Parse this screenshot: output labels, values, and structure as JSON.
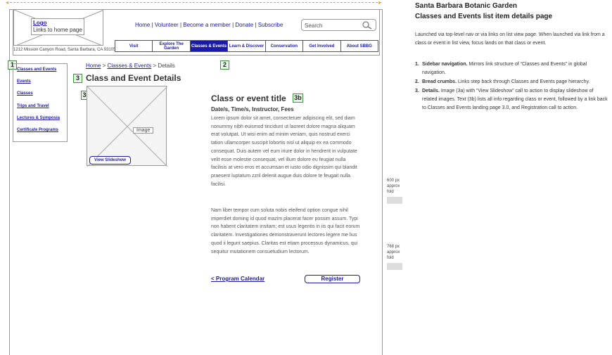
{
  "header": {
    "logo_title": "Logo",
    "logo_subtitle": "Links to home page",
    "address": "1212 Mission Canyon Road, Santa Barbara, CA 93105",
    "utility_links": [
      "Home",
      "Volunteer",
      "Become a member",
      "Donate",
      "Subscribe"
    ],
    "search_placeholder": "Search"
  },
  "nav": [
    {
      "label": "Visit",
      "active": false
    },
    {
      "label": "Explore The Garden",
      "active": false
    },
    {
      "label": "Classes & Events",
      "active": true
    },
    {
      "label": "Learn & Discover",
      "active": false
    },
    {
      "label": "Conservation",
      "active": false
    },
    {
      "label": "Get Involved",
      "active": false
    },
    {
      "label": "About SBBG",
      "active": false
    }
  ],
  "callouts": {
    "c1": "1",
    "c2": "2",
    "c3": "3",
    "c3a": "3a",
    "c3b": "3b"
  },
  "sidebar": {
    "items": [
      "Classes and Events",
      "Events",
      "Classes",
      "Trips and Travel",
      "Lectures & Symposia",
      "Certificate Programs"
    ]
  },
  "breadcrumb": {
    "home": "Home",
    "section": "Classes & Events",
    "current": "Details",
    "sep": ">"
  },
  "main": {
    "page_title": "Class and Event Details",
    "image_label": "Image",
    "slideshow_label": "View Slideshow",
    "event_title": "Class or event title",
    "event_meta": "Date/s, Time/s, Instructor, Fees",
    "paragraph1": "Lorem ipsum dolor sit amet, consectetuer adipiscing elit, sed diam nonummy nibh euismod tincidunt ut laoreet dolore magna aliquam erat volutpat. Ut wisi enim ad minim veniam, quis nostrud exerci tation ullamcorper suscipit lobortis nisl ut aliquip ex ea commodo consequat. Duis autem vel eum iriure dolor in hendrerit in vulputate velit esse molestie consequat, vel illum dolore eu feugiat nulla facilisis at vero eros et accumsan et iusto odio dignissim qui blandit praesent luptatum zzril delenit augue duis dolore te feugait nulla facilisi.",
    "paragraph2": "Nam liber tempor cum soluta nobis eleifend option congue nihil imperdiet doming id quod mazim placerat facer possim assum. Typi non habent claritatem insitam; est usus legentis in iis qui facit eorum claritatem. Investigationes demonstraverunt lectores legere me lius quod ii legunt saepius. Claritas est etiam processus dynamicus, qui sequitur mutationem consuetudium lectorum.",
    "program_link": "< Program Calendar",
    "register_label": "Register"
  },
  "folds": {
    "fold600": [
      "600 px",
      "approx",
      "fold"
    ],
    "fold768": [
      "768 px",
      "approx",
      "fold"
    ]
  },
  "annotations": {
    "title_line1": "Santa Barbara Botanic Garden",
    "title_line2": "Classes and Events list item details page",
    "intro": "Launched via top-level nav or via links on list view page. When launched via link from a class or event in list view, focus lands on that class or event.",
    "items": [
      {
        "num": "1.",
        "lead": "Sidebar navigation.",
        "text": " Mirrors link structure of “Classes and Events” in global navigation."
      },
      {
        "num": "2.",
        "lead": "Bread crumbs.",
        "text": " Links step back through Classes and Events page hierarchy."
      },
      {
        "num": "3.",
        "lead": "Details.",
        "text": " Image (3a) with “View Slideshow” call to action to display slideshow of related images. Text (3b) lists all info regarding class or event, followed by a link back to Classes and Events landing page 3.0, and Registration call to action."
      }
    ]
  },
  "colors": {
    "link": "#1a1aa6",
    "callout_border": "#3a9a3a",
    "ruler": "#f0a030"
  }
}
